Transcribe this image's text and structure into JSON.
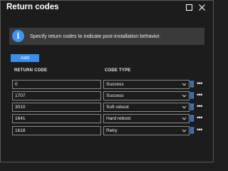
{
  "window": {
    "title": "Return codes",
    "maximize_icon": "maximize-icon",
    "close_icon": "close-icon"
  },
  "info": {
    "icon": "info-icon",
    "text": "Specify return codes to indicate post-installation behavior."
  },
  "toolbar": {
    "add_label": "Add"
  },
  "table": {
    "headers": {
      "return_code": "RETURN CODE",
      "code_type": "CODE TYPE"
    },
    "rows": [
      {
        "code": "0",
        "type": "Success"
      },
      {
        "code": "1707",
        "type": "Success"
      },
      {
        "code": "3010",
        "type": "Soft reboot"
      },
      {
        "code": "1641",
        "type": "Hard reboot"
      },
      {
        "code": "1618",
        "type": "Retry"
      }
    ],
    "row_actions": {
      "delete_icon": "trash-icon",
      "more_label": "•••"
    }
  },
  "colors": {
    "background": "#1c1c1c",
    "info_banner": "#3a3a3a",
    "accent": "#3b8eea",
    "trash": "#4a90e2"
  }
}
